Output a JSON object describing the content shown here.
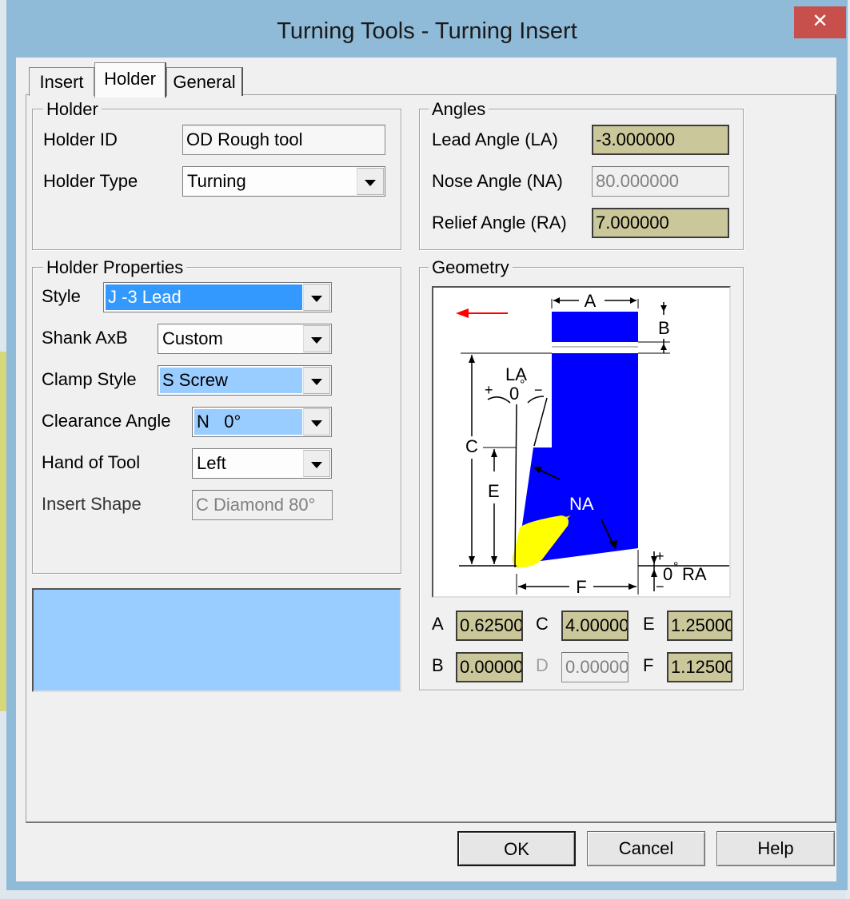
{
  "window": {
    "title": "Turning Tools - Turning Insert",
    "close": "✕"
  },
  "tabs": [
    {
      "label": "Insert"
    },
    {
      "label": "Holder"
    },
    {
      "label": "General"
    }
  ],
  "holder_group": {
    "title": "Holder",
    "holder_id_label": "Holder ID",
    "holder_id_value": "OD Rough tool",
    "holder_type_label": "Holder Type",
    "holder_type_value": "Turning"
  },
  "angles_group": {
    "title": "Angles",
    "lead_label": "Lead Angle (LA)",
    "lead_value": "-3.000000",
    "nose_label": "Nose Angle (NA)",
    "nose_value": "80.000000",
    "relief_label": "Relief Angle (RA)",
    "relief_value": "7.000000"
  },
  "properties_group": {
    "title": "Holder Properties",
    "style_label": "Style",
    "style_value": "J -3 Lead",
    "shank_label": "Shank AxB",
    "shank_value": "Custom",
    "clamp_label": "Clamp Style",
    "clamp_value": "S Screw",
    "clearance_label": "Clearance Angle",
    "clearance_value": "N   0°",
    "hand_label": "Hand of Tool",
    "hand_value": "Left",
    "shape_label": "Insert Shape",
    "shape_value": "C Diamond 80°"
  },
  "geometry_group": {
    "title": "Geometry",
    "diagram": {
      "A": "A",
      "B": "B",
      "C": "C",
      "E": "E",
      "F": "F",
      "LA": "LA",
      "NA": "NA",
      "RA": "RA",
      "zero": "0",
      "degree": "°",
      "plus": "+",
      "minus": "−",
      "colors": {
        "holder": "#0000ff",
        "insert": "#ffff00",
        "arrow": "#ff0000"
      }
    },
    "A_label": "A",
    "A_value": "0.62500",
    "B_label": "B",
    "B_value": "0.00000",
    "C_label": "C",
    "C_value": "4.00000",
    "D_label": "D",
    "D_value": "0.00000",
    "E_label": "E",
    "E_value": "1.25000",
    "F_label": "F",
    "F_value": "1.12500"
  },
  "buttons": {
    "ok": "OK",
    "cancel": "Cancel",
    "help": "Help"
  },
  "colors": {
    "titlebar": "#8fbad8",
    "close": "#c7504c",
    "highlight_field": "#cac79a",
    "selection": "#3399ff",
    "light_selection": "#99ccff"
  }
}
